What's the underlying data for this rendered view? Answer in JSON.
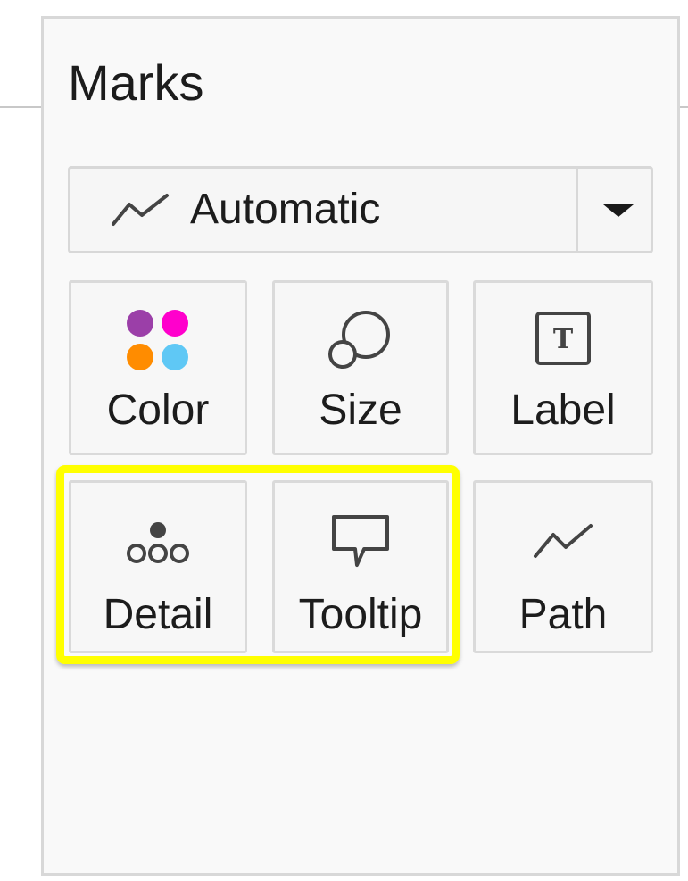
{
  "marks": {
    "title": "Marks",
    "mark_type": {
      "value": "Automatic",
      "icon": "line-mark-icon"
    },
    "cards": [
      {
        "label": "Color",
        "icon": "color-palette-icon"
      },
      {
        "label": "Size",
        "icon": "size-icon"
      },
      {
        "label": "Label",
        "icon": "text-label-icon"
      },
      {
        "label": "Detail",
        "icon": "detail-icon"
      },
      {
        "label": "Tooltip",
        "icon": "tooltip-icon"
      },
      {
        "label": "Path",
        "icon": "path-icon"
      }
    ],
    "highlighted_cards": [
      "Detail",
      "Tooltip"
    ]
  },
  "colors": {
    "highlight": "#ffff00",
    "palette": [
      "#9b3fa8",
      "#ff00cc",
      "#ff8c00",
      "#5fc8f5"
    ]
  }
}
